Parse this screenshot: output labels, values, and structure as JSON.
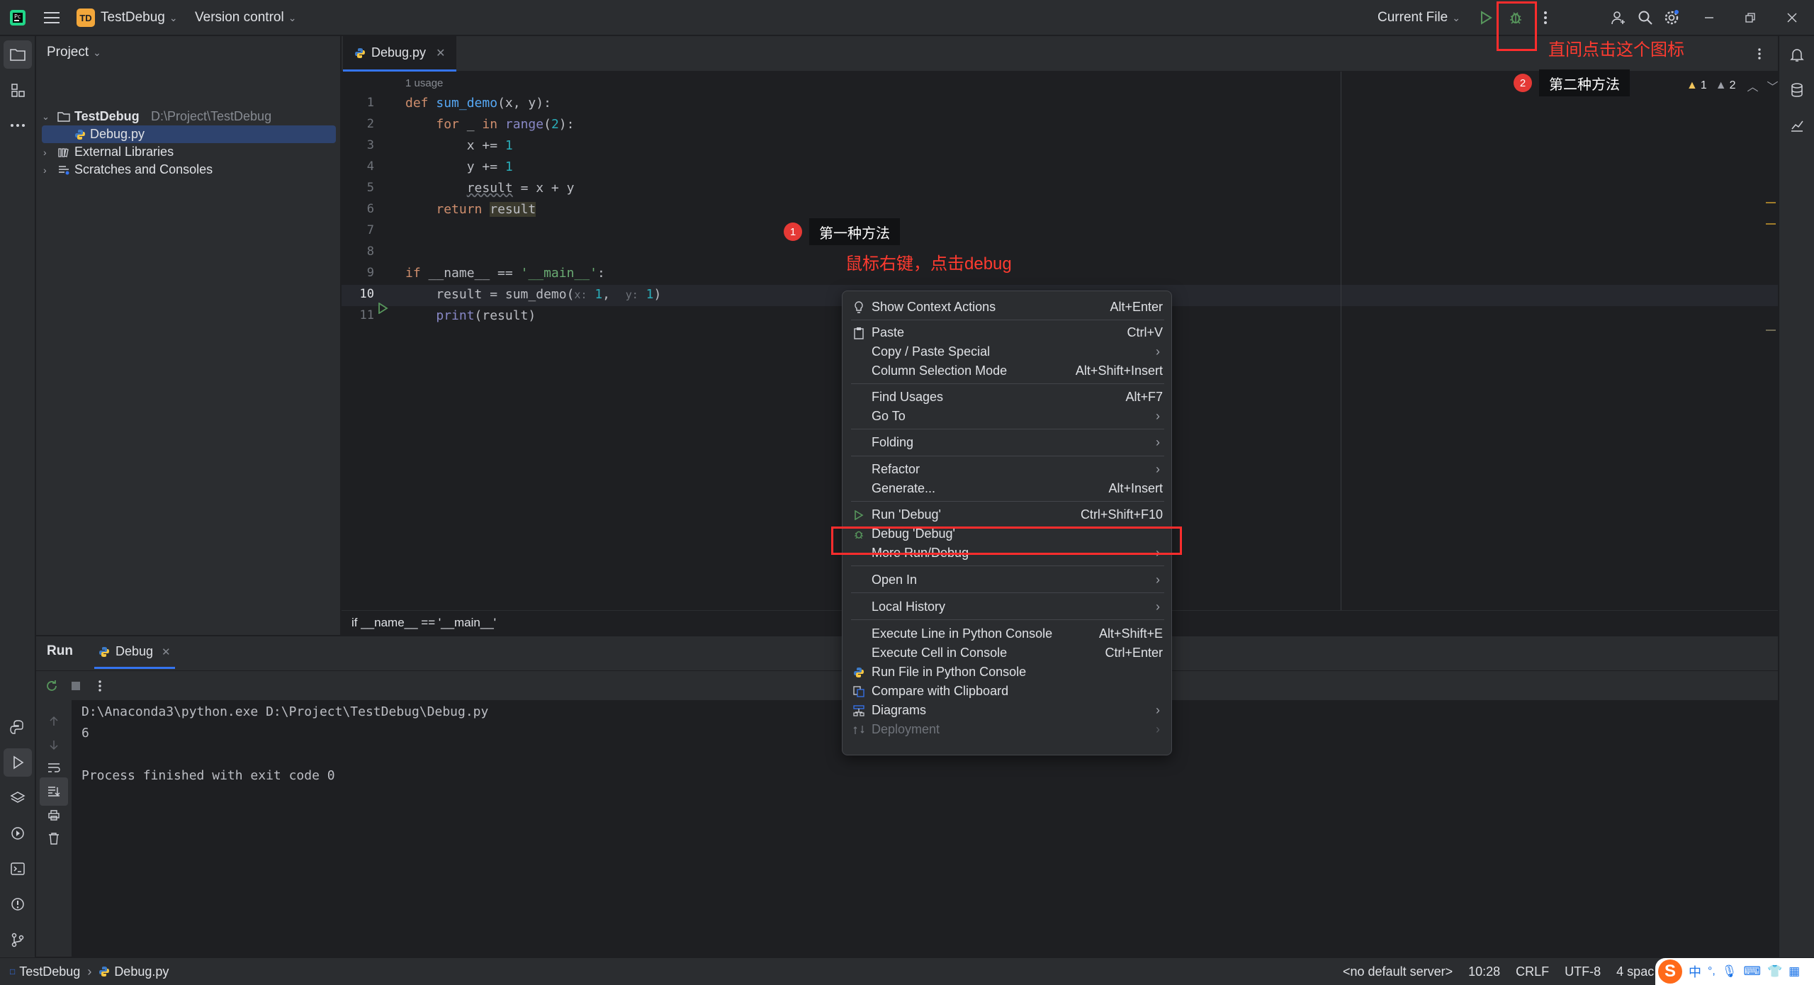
{
  "titlebar": {
    "app_badge": "TD",
    "project_name": "TestDebug",
    "vcs_label": "Version control",
    "run_config": "Current File"
  },
  "project_panel": {
    "title": "Project",
    "root_name": "TestDebug",
    "root_path": "D:\\Project\\TestDebug",
    "file": "Debug.py",
    "external_libraries": "External Libraries",
    "scratches": "Scratches and Consoles"
  },
  "editor": {
    "tab": "Debug.py",
    "usage_hint": "1 usage",
    "inspection_warnings": "1",
    "inspection_weak": "2",
    "line_numbers": [
      "1",
      "2",
      "3",
      "4",
      "5",
      "6",
      "7",
      "8",
      "9",
      "10",
      "11"
    ],
    "breadcrumb": "if __name__ == '__main__'"
  },
  "context_menu": {
    "items": [
      {
        "label": "Show Context Actions",
        "shortcut": "Alt+Enter"
      },
      {
        "label": "Paste",
        "shortcut": "Ctrl+V"
      },
      {
        "label": "Copy / Paste Special",
        "shortcut": ""
      },
      {
        "label": "Column Selection Mode",
        "shortcut": "Alt+Shift+Insert"
      },
      {
        "label": "Find Usages",
        "shortcut": "Alt+F7"
      },
      {
        "label": "Go To",
        "shortcut": ""
      },
      {
        "label": "Folding",
        "shortcut": ""
      },
      {
        "label": "Refactor",
        "shortcut": ""
      },
      {
        "label": "Generate...",
        "shortcut": "Alt+Insert"
      },
      {
        "label": "Run 'Debug'",
        "shortcut": "Ctrl+Shift+F10"
      },
      {
        "label": "Debug 'Debug'",
        "shortcut": ""
      },
      {
        "label": "More Run/Debug",
        "shortcut": ""
      },
      {
        "label": "Open In",
        "shortcut": ""
      },
      {
        "label": "Local History",
        "shortcut": ""
      },
      {
        "label": "Execute Line in Python Console",
        "shortcut": "Alt+Shift+E"
      },
      {
        "label": "Execute Cell in Console",
        "shortcut": "Ctrl+Enter"
      },
      {
        "label": "Run File in Python Console",
        "shortcut": ""
      },
      {
        "label": "Compare with Clipboard",
        "shortcut": ""
      },
      {
        "label": "Diagrams",
        "shortcut": ""
      },
      {
        "label": "Deployment",
        "shortcut": ""
      }
    ]
  },
  "annotations": {
    "method1_num": "1",
    "method1_label": "第一种方法",
    "method1_hint": "鼠标右键，点击debug",
    "method2_num": "2",
    "method2_label": "第二种方法",
    "method2_hint": "直间点击这个图标",
    "highlight_color": "#ff2d2d"
  },
  "run_panel": {
    "tab_run": "Run",
    "tab_debug": "Debug",
    "console_lines": [
      "D:\\Anaconda3\\python.exe D:\\Project\\TestDebug\\Debug.py",
      "6",
      "",
      "Process finished with exit code 0"
    ]
  },
  "statusbar": {
    "crumb_project": "TestDebug",
    "crumb_file": "Debug.py",
    "server": "<no default server>",
    "position": "10:28",
    "line_sep": "CRLF",
    "encoding": "UTF-8",
    "indent": "4 spac",
    "ime_lang": "中"
  }
}
